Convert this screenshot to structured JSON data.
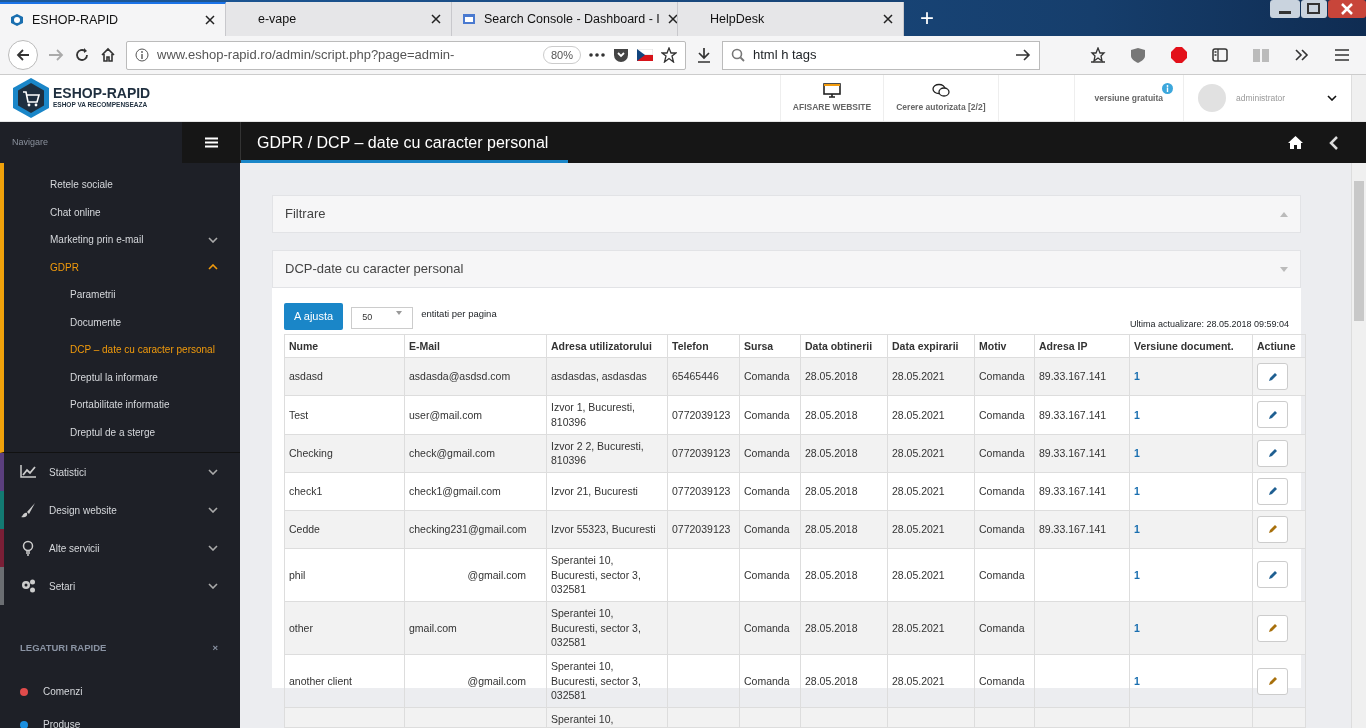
{
  "browser": {
    "tabs": [
      {
        "title": "ESHOP-RAPID",
        "selected": true,
        "kind": "shield"
      },
      {
        "title": "e-vape",
        "selected": false
      },
      {
        "title": "Search Console - Dashboard - I",
        "selected": false,
        "kind": "console"
      },
      {
        "title": "HelpDesk",
        "selected": false
      }
    ],
    "new_tab": "+",
    "address": "www.eshop-rapid.ro/admin/script.php?page=admin-",
    "zoom": "80%",
    "search": "html h tags"
  },
  "header": {
    "logo_title": "ESHOP-RAPID",
    "logo_subtitle": "ESHOP VA RECOMPENSEAZA",
    "actions": [
      {
        "label": "AFISARE WEBSITE",
        "kind": "monitor"
      },
      {
        "label": "Cerere autorizata [2/2]",
        "kind": "chat"
      }
    ],
    "version": "versiune gratuita",
    "user": "administrator"
  },
  "sidebar": {
    "title": "Navigare",
    "items": [
      {
        "label": "Retele sociale"
      },
      {
        "label": "Chat online"
      },
      {
        "label": "Marketing prin e-mail",
        "expanded": false
      },
      {
        "label": "GDPR",
        "expanded": true,
        "selected": true,
        "children": [
          {
            "label": "Parametrii",
            "selected": false
          },
          {
            "label": "Documente",
            "selected": false
          },
          {
            "label": "DCP – date cu caracter personal",
            "selected": true
          },
          {
            "label": "Dreptul la informare",
            "selected": false
          },
          {
            "label": "Portabilitate informatie",
            "selected": false
          },
          {
            "label": "Dreptul de a sterge",
            "selected": false
          }
        ]
      }
    ],
    "sections": [
      {
        "label": "Statistici",
        "kind": "chart",
        "color": "#5b3f7e",
        "expanded": false
      },
      {
        "label": "Design website",
        "kind": "brush",
        "color": "#137a72",
        "expanded": false
      },
      {
        "label": "Alte servicii",
        "kind": "bulb",
        "color": "#7a1f36",
        "expanded": false
      },
      {
        "label": "Setari",
        "kind": "gears",
        "color": "#6b6e72",
        "expanded": false
      }
    ],
    "quick_title": "LEGATURI RAPIDE",
    "quick_close": "×",
    "quick_links": [
      {
        "label": "Comenzi",
        "color": "#e04b4b"
      },
      {
        "label": "Produse",
        "color": "#1a8fe0"
      }
    ]
  },
  "page": {
    "title": "GDPR / DCP – date cu caracter personal",
    "panels": [
      {
        "title": "Filtrare",
        "expanded": false
      },
      {
        "title": "DCP-date cu caracter personal",
        "expanded": true
      }
    ],
    "adjust_button": "A ajusta",
    "page_size": "50",
    "page_size_label": "entitati per pagina",
    "updated": "Ultima actualizare: 28.05.2018 09:59:04",
    "table": {
      "columns": [
        "Nume",
        "E-Mail",
        "Adresa utilizatorului",
        "Telefon",
        "Sursa",
        "Data obtinerii",
        "Data expirarii",
        "Motiv",
        "Adresa IP",
        "Versiune document.",
        "Actiune"
      ],
      "rows": [
        {
          "name": "asdasd",
          "email": "asdasda@asdsd.com",
          "address": "asdasdas, asdasdas",
          "phone": "65465446",
          "source": "Comanda",
          "obtained": "28.05.2018",
          "expires": "28.05.2021",
          "reason": "Comanda",
          "ip": "89.33.167.141",
          "version": "1",
          "color": "#1f5f91"
        },
        {
          "name": "Test",
          "email": "user@mail.com",
          "address": "Izvor 1, Bucuresti, 810396",
          "phone": "0772039123",
          "source": "Comanda",
          "obtained": "28.05.2018",
          "expires": "28.05.2021",
          "reason": "Comanda",
          "ip": "89.33.167.141",
          "version": "1",
          "color": "#1f5f91"
        },
        {
          "name": "Checking",
          "email": "check@gmail.com",
          "address": "Izvor 2 2, Bucuresti, 810396",
          "phone": "0772039123",
          "source": "Comanda",
          "obtained": "28.05.2018",
          "expires": "28.05.2021",
          "reason": "Comanda",
          "ip": "89.33.167.141",
          "version": "1",
          "color": "#1f5f91"
        },
        {
          "name": "check1",
          "email": "check1@gmail.com",
          "address": "Izvor 21, Bucuresti",
          "phone": "0772039123",
          "source": "Comanda",
          "obtained": "28.05.2018",
          "expires": "28.05.2021",
          "reason": "Comanda",
          "ip": "89.33.167.141",
          "version": "1",
          "color": "#1f5f91"
        },
        {
          "name": "Cedde",
          "email": "checking231@gmail.com",
          "address": "Izvor 55323, Bucuresti",
          "phone": "0772039123",
          "source": "Comanda",
          "obtained": "28.05.2018",
          "expires": "28.05.2021",
          "reason": "Comanda",
          "ip": "89.33.167.141",
          "version": "1",
          "color": "#a8700c"
        },
        {
          "name": "phil",
          "email": "@gmail.com",
          "address": "Sperantei 10, Bucuresti, sector 3, 032581",
          "source": "Comanda",
          "obtained": "28.05.2018",
          "expires": "28.05.2021",
          "reason": "Comanda",
          "version": "1",
          "color": "#1f5f91"
        },
        {
          "name": "other",
          "email": "gmail.com",
          "address": "Sperantei 10, Bucuresti, sector 3, 032581",
          "source": "Comanda",
          "obtained": "28.05.2018",
          "expires": "28.05.2021",
          "reason": "Comanda",
          "version": "1",
          "color": "#a8700c"
        },
        {
          "name": "another client",
          "email": "@gmail.com",
          "address": "Sperantei 10, Bucuresti, sector 3, 032581",
          "source": "Comanda",
          "obtained": "28.05.2018",
          "expires": "28.05.2021",
          "reason": "Comanda",
          "version": "1",
          "color": "#a8700c"
        },
        {
          "address": "Sperantei 10,"
        }
      ]
    }
  }
}
